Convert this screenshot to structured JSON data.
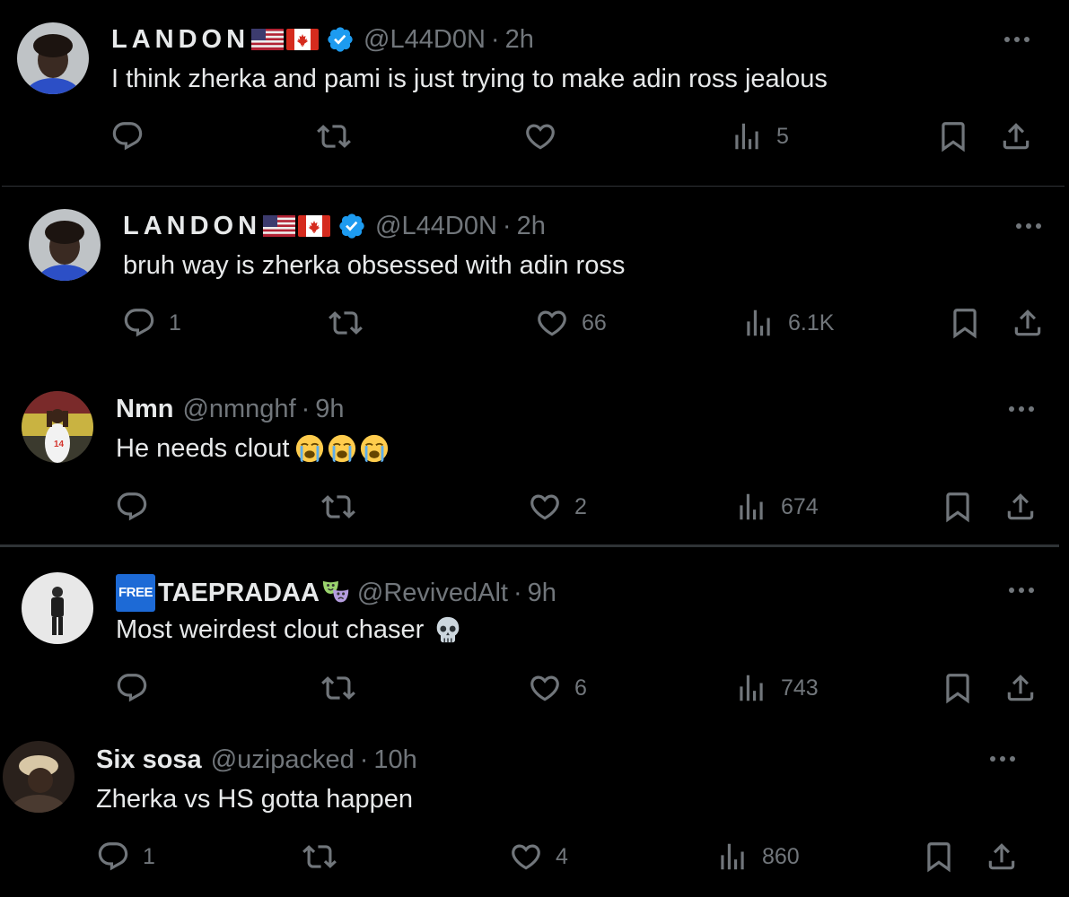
{
  "tweets": [
    {
      "name": "LANDON",
      "handle": "@L44D0N",
      "dot": "·",
      "time": "2h",
      "text": "I think zherka and pami is just trying to make adin ross jealous",
      "reply_count": "",
      "like_count": "",
      "view_count": "5",
      "flags": [
        "us-flag-icon",
        "canada-flag-icon"
      ],
      "verified": true
    },
    {
      "name": "LANDON",
      "handle": "@L44D0N",
      "dot": "·",
      "time": "2h",
      "text": "bruh way is zherka obsessed with adin ross",
      "reply_count": "1",
      "like_count": "66",
      "view_count": "6.1K",
      "flags": [
        "us-flag-icon",
        "canada-flag-icon"
      ],
      "verified": true
    },
    {
      "name": "Nmn",
      "handle": "@nmnghf",
      "dot": "·",
      "time": "9h",
      "text": "He needs clout",
      "reply_count": "",
      "like_count": "2",
      "view_count": "674",
      "emojis": [
        "loudly-crying-face-icon",
        "loudly-crying-face-icon",
        "loudly-crying-face-icon"
      ]
    },
    {
      "badge": "FREE",
      "name": "TAEPRADAA",
      "handle": "@RevivedAlt",
      "dot": "·",
      "time": "9h",
      "text": "Most weirdest clout chaser",
      "reply_count": "",
      "like_count": "6",
      "view_count": "743",
      "emojis": [
        "skull-icon"
      ],
      "name_emoji": "performing-arts-icon"
    },
    {
      "name": "Six sosa",
      "handle": "@uzipacked",
      "dot": "·",
      "time": "10h",
      "text": "Zherka vs HS gotta happen",
      "reply_count": "1",
      "like_count": "4",
      "view_count": "860"
    }
  ],
  "colors": {
    "background": "#000000",
    "text": "#e7e9ea",
    "muted": "#71767b",
    "verified": "#1d9bf0",
    "divider": "#2f3336"
  }
}
